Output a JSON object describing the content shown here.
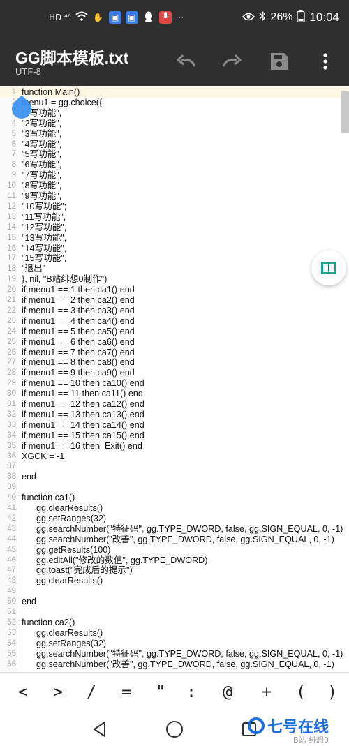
{
  "status_bar": {
    "network": "HD ⁴⁶",
    "battery": "26%",
    "time": "10:04"
  },
  "app_bar": {
    "title": "GG脚本模板.txt",
    "encoding": "UTF-8"
  },
  "editor": {
    "current_line": 1,
    "lines": [
      {
        "n": "1",
        "text": "function Main()"
      },
      {
        "n": "2",
        "text": "menu1 = gg.choice({"
      },
      {
        "n": "3",
        "text": "\"1写功能\","
      },
      {
        "n": "4",
        "text": "\"2写功能\","
      },
      {
        "n": "5",
        "text": "\"3写功能\","
      },
      {
        "n": "6",
        "text": "\"4写功能\","
      },
      {
        "n": "7",
        "text": "\"5写功能\","
      },
      {
        "n": "8",
        "text": "\"6写功能\","
      },
      {
        "n": "9",
        "text": "\"7写功能\","
      },
      {
        "n": "10",
        "text": "\"8写功能\","
      },
      {
        "n": "11",
        "text": "\"9写功能\","
      },
      {
        "n": "12",
        "text": "\"10写功能\";"
      },
      {
        "n": "13",
        "text": "\"11写功能\","
      },
      {
        "n": "14",
        "text": "\"12写功能\","
      },
      {
        "n": "15",
        "text": "\"13写功能\","
      },
      {
        "n": "16",
        "text": "\"14写功能\","
      },
      {
        "n": "17",
        "text": "\"15写功能\","
      },
      {
        "n": "18",
        "text": "\"退出\""
      },
      {
        "n": "19",
        "text": "}, nil, \"B站绯想0制作\")"
      },
      {
        "n": "20",
        "text": "if menu1 == 1 then ca1() end"
      },
      {
        "n": "21",
        "text": "if menu1 == 2 then ca2() end"
      },
      {
        "n": "22",
        "text": "if menu1 == 3 then ca3() end"
      },
      {
        "n": "23",
        "text": "if menu1 == 4 then ca4() end"
      },
      {
        "n": "24",
        "text": "if menu1 == 5 then ca5() end"
      },
      {
        "n": "25",
        "text": "if menu1 == 6 then ca6() end"
      },
      {
        "n": "26",
        "text": "if menu1 == 7 then ca7() end"
      },
      {
        "n": "27",
        "text": "if menu1 == 8 then ca8() end"
      },
      {
        "n": "28",
        "text": "if menu1 == 9 then ca9() end"
      },
      {
        "n": "29",
        "text": "if menu1 == 10 then ca10() end"
      },
      {
        "n": "30",
        "text": "if menu1 == 11 then ca11() end"
      },
      {
        "n": "31",
        "text": "if menu1 == 12 then ca12() end"
      },
      {
        "n": "32",
        "text": "if menu1 == 13 then ca13() end"
      },
      {
        "n": "33",
        "text": "if menu1 == 14 then ca14() end"
      },
      {
        "n": "34",
        "text": "if menu1 == 15 then ca15() end"
      },
      {
        "n": "35",
        "text": "if menu1 == 16 then  Exit() end"
      },
      {
        "n": "36",
        "text": "XGCK = -1"
      },
      {
        "n": "37",
        "text": ""
      },
      {
        "n": "38",
        "text": "end"
      },
      {
        "n": "39",
        "text": ""
      },
      {
        "n": "40",
        "text": "function ca1()"
      },
      {
        "n": "41",
        "text": "      gg.clearResults()"
      },
      {
        "n": "42",
        "text": "      gg.setRanges(32)"
      },
      {
        "n": "43",
        "text": "      gg.searchNumber(\"特征码\", gg.TYPE_DWORD, false, gg.SIGN_EQUAL, 0, -1)"
      },
      {
        "n": "44",
        "text": "      gg.searchNumber(\"改善\", gg.TYPE_DWORD, false, gg.SIGN_EQUAL, 0, -1)"
      },
      {
        "n": "45",
        "text": "      gg.getResults(100)"
      },
      {
        "n": "46",
        "text": "      gg.editAll(\"修改的数值\", gg.TYPE_DWORD)"
      },
      {
        "n": "47",
        "text": "      gg.toast(\"完成后的提示\")"
      },
      {
        "n": "48",
        "text": "      gg.clearResults()"
      },
      {
        "n": "49",
        "text": ""
      },
      {
        "n": "50",
        "text": "end"
      },
      {
        "n": "51",
        "text": ""
      },
      {
        "n": "52",
        "text": "function ca2()"
      },
      {
        "n": "53",
        "text": "      gg.clearResults()"
      },
      {
        "n": "54",
        "text": "      gg.setRanges(32)"
      },
      {
        "n": "55",
        "text": "      gg.searchNumber(\"特征码\", gg.TYPE_DWORD, false, gg.SIGN_EQUAL, 0, -1)"
      },
      {
        "n": "56",
        "text": "      gg.searchNumber(\"改善\", gg.TYPE_DWORD, false, gg.SIGN_EQUAL, 0, -1)"
      }
    ]
  },
  "symbol_bar": {
    "keys": [
      "<",
      ">",
      "/",
      "=",
      "\"",
      ":",
      "@",
      "+",
      "(",
      ")"
    ]
  },
  "watermark": {
    "brand": "七号在线",
    "sub": "B站 绯想0"
  },
  "colors": {
    "bar_dark": "#2f2f2f",
    "current_line": "#fdf8e3",
    "handle_blue": "#3d93f2",
    "watermark_blue": "#1f6fe0"
  }
}
